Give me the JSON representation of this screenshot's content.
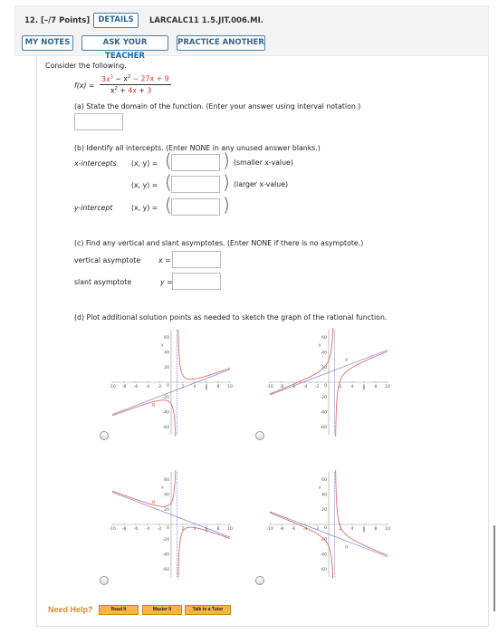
{
  "header": {
    "question_number": "12.",
    "points": "[–/7 Points]",
    "details_label": "DETAILS",
    "problem_code": "LARCALC11 1.5.JIT.006.MI.",
    "my_notes_label": "MY NOTES",
    "ask_teacher_label": "ASK YOUR TEACHER",
    "practice_another_label": "PRACTICE ANOTHER"
  },
  "problem": {
    "intro": "Consider the following.",
    "function_lhs": "f(x) =",
    "numerator_parts": [
      "3x",
      "3",
      " − x",
      "2",
      " − 27x + ",
      "9"
    ],
    "denominator_parts": [
      "x",
      "2",
      " + ",
      "4x",
      " + ",
      "3"
    ],
    "part_a": {
      "prompt": "(a) State the domain of the function. (Enter your answer using interval notation.)",
      "value": ""
    },
    "part_b": {
      "prompt": "(b) Identify all intercepts. (Enter NONE in any unused answer blanks.)",
      "x_intercepts_label": "x-intercepts",
      "y_intercept_label": "y-intercept",
      "xy_label": "(x, y) =",
      "smaller_note": "(smaller x-value)",
      "larger_note": "(larger x-value)",
      "values": [
        "",
        "",
        ""
      ]
    },
    "part_c": {
      "prompt": "(c) Find any vertical and slant asymptotes. (Enter NONE if there is no asymptote.)",
      "vertical_label": "vertical asymptote",
      "vertical_var": "x =",
      "slant_label": "slant asymptote",
      "slant_var": "y =",
      "vertical_value": "",
      "slant_value": ""
    },
    "part_d": {
      "prompt": "(d) Plot additional solution points as needed to sketch the graph of the rational function."
    }
  },
  "chart_data": [
    {
      "type": "line",
      "option": 1,
      "xlabel": "x",
      "ylabel": "y",
      "xlim": [
        -10,
        10
      ],
      "ylim": [
        -70,
        70
      ],
      "xticks": [
        -10,
        -8,
        -6,
        -4,
        -2,
        2,
        4,
        6,
        8,
        10
      ],
      "yticks": [
        -60,
        -40,
        -20,
        20,
        40,
        60
      ],
      "vertical_asymptote": 1,
      "slant_asymptote": {
        "slope": 3,
        "intercept": -13
      },
      "hole": {
        "x": -3,
        "y": -30
      },
      "series": [
        {
          "name": "f",
          "formula": "(3x-1)(x-3)/(x-1) style: branch right passes near (0.3,0)"
        },
        {
          "name": "asymptote",
          "color": "#6b6bd6"
        }
      ]
    },
    {
      "type": "line",
      "option": 2,
      "xlabel": "x",
      "ylabel": "y",
      "xlim": [
        -10,
        10
      ],
      "ylim": [
        -70,
        70
      ],
      "xticks": [
        -10,
        -8,
        -6,
        -4,
        -2,
        2,
        4,
        6,
        8,
        10
      ],
      "yticks": [
        -60,
        -40,
        -20,
        20,
        40,
        60
      ],
      "vertical_asymptote": 1,
      "slant_asymptote": {
        "slope": 3,
        "intercept": 13
      },
      "hole": {
        "x": 3,
        "y": 30
      }
    },
    {
      "type": "line",
      "option": 3,
      "xlabel": "x",
      "ylabel": "y",
      "xlim": [
        -10,
        10
      ],
      "ylim": [
        -70,
        70
      ],
      "xticks": [
        -10,
        -8,
        -6,
        -4,
        -2,
        2,
        4,
        6,
        8,
        10
      ],
      "yticks": [
        -60,
        -40,
        -20,
        20,
        40,
        60
      ],
      "vertical_asymptote": 1,
      "slant_asymptote": {
        "slope": -3,
        "intercept": 13
      },
      "hole": {
        "x": -3,
        "y": 30
      }
    },
    {
      "type": "line",
      "option": 4,
      "xlabel": "x",
      "ylabel": "y",
      "xlim": [
        -10,
        10
      ],
      "ylim": [
        -70,
        70
      ],
      "xticks": [
        -10,
        -8,
        -6,
        -4,
        -2,
        2,
        4,
        6,
        8,
        10
      ],
      "yticks": [
        -60,
        -40,
        -20,
        20,
        40,
        60
      ],
      "vertical_asymptote": 1,
      "slant_asymptote": {
        "slope": -3,
        "intercept": -13
      },
      "hole": {
        "x": 3,
        "y": -30
      }
    }
  ],
  "help": {
    "label": "Need Help?",
    "read_it": "Read It",
    "master_it": "Master It",
    "talk_tutor": "Talk to a Tutor"
  },
  "colors": {
    "curve": "#e36c6c",
    "asymptote": "#6b6bd6",
    "button_border": "#4a7fa5",
    "help": "#e28a2b"
  }
}
